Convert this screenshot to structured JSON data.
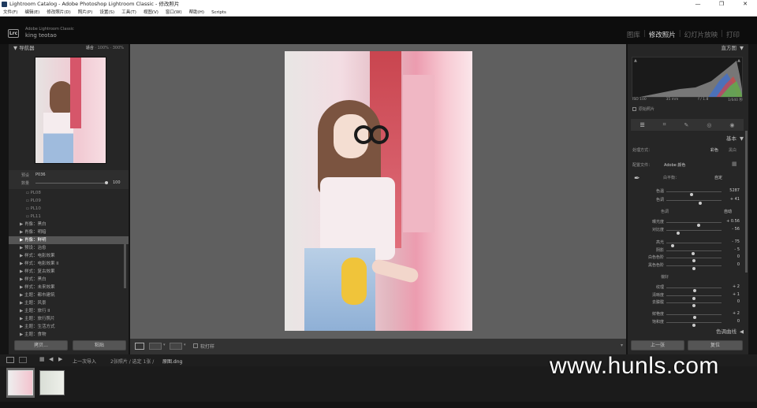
{
  "window": {
    "title": "Lightroom Catalog - Adobe Photoshop Lightroom Classic - 修改照片",
    "controls": [
      "—",
      "❐",
      "✕"
    ]
  },
  "menu": [
    "文件(F)",
    "编辑(E)",
    "修改照片(D)",
    "照片(P)",
    "设置(S)",
    "工具(T)",
    "视图(V)",
    "窗口(W)",
    "帮助(H)",
    "Scripts"
  ],
  "identity": {
    "logo": "Lrc",
    "product": "Adobe Lightroom Classic",
    "user": "king teotao"
  },
  "modules": [
    {
      "label": "图库",
      "active": false
    },
    {
      "label": "修改照片",
      "active": true
    },
    {
      "label": "幻灯片放映",
      "active": false
    },
    {
      "label": "打印",
      "active": false
    }
  ],
  "navigator": {
    "title": "导航器",
    "zoom": [
      "适合",
      "100%",
      "300%"
    ]
  },
  "preset_amount": {
    "preset_label": "预设",
    "preset_value": "P036",
    "amount_label": "数量",
    "amount_value": "100",
    "amount_level": 1.0
  },
  "presets": [
    {
      "label": "PL08",
      "type": "sub"
    },
    {
      "label": "PL09",
      "type": "sub"
    },
    {
      "label": "PL10",
      "type": "sub"
    },
    {
      "label": "PL11",
      "type": "sub"
    },
    {
      "label": "肖像：黑白",
      "type": "folder"
    },
    {
      "label": "肖像：明暗",
      "type": "folder"
    },
    {
      "label": "肖像：鲜明",
      "type": "folder",
      "selected": true
    },
    {
      "label": "预设：治愈",
      "type": "folder"
    },
    {
      "label": "样式：电影效果",
      "type": "folder"
    },
    {
      "label": "样式：电影效果 II",
      "type": "folder"
    },
    {
      "label": "样式：复古效果",
      "type": "folder"
    },
    {
      "label": "样式：黑白",
      "type": "folder"
    },
    {
      "label": "样式：未来效果",
      "type": "folder"
    },
    {
      "label": "主题：都市建筑",
      "type": "folder"
    },
    {
      "label": "主题：风景",
      "type": "folder"
    },
    {
      "label": "主题：旅行 II",
      "type": "folder"
    },
    {
      "label": "主题：旅行照片",
      "type": "folder"
    },
    {
      "label": "主题：生活方式",
      "type": "folder"
    },
    {
      "label": "主题：食物",
      "type": "folder"
    }
  ],
  "left_buttons": {
    "copy": "拷贝...",
    "paste": "粘贴"
  },
  "right_panel": {
    "histogram_title": "直方图",
    "histogram_info": [
      "ISO 100",
      "35 mm",
      "f / 1.8",
      "1/640 秒"
    ],
    "original_photo": "原始照片",
    "basic_title": "基本",
    "treatment_label": "处理方式：",
    "treatment_options": [
      "彩色",
      "黑白"
    ],
    "profile_label": "配置文件：",
    "profile_value": "Adobe 颜色",
    "wb_label": "白平衡：",
    "wb_value": "自定",
    "tone_label": "色调",
    "tone_auto": "自动",
    "presence_label": "偏好",
    "tone_curve_title": "色调曲线",
    "prev_button": "上一张",
    "reset_button": "复位"
  },
  "sliders": [
    {
      "label": "色温",
      "value": "5287",
      "level": 0.45
    },
    {
      "label": "色调",
      "value": "+ 41",
      "level": 0.62
    },
    {
      "label": "曝光度",
      "value": "+ 0.56",
      "level": 0.58
    },
    {
      "label": "对比度",
      "value": "- 56",
      "level": 0.22
    },
    {
      "label": "高光",
      "value": "- 75",
      "level": 0.12
    },
    {
      "label": "阴影",
      "value": "- 5",
      "level": 0.48
    },
    {
      "label": "白色色阶",
      "value": "0",
      "level": 0.5
    },
    {
      "label": "黑色色阶",
      "value": "0",
      "level": 0.5
    },
    {
      "label": "纹理",
      "value": "+ 2",
      "level": 0.51
    },
    {
      "label": "清晰度",
      "value": "+ 1",
      "level": 0.505
    },
    {
      "label": "去朦胧",
      "value": "0",
      "level": 0.5
    },
    {
      "label": "鲜艳度",
      "value": "+ 2",
      "level": 0.51
    },
    {
      "label": "饱和度",
      "value": "0",
      "level": 0.5
    }
  ],
  "toolbar": {
    "soft_proof": "软打样"
  },
  "filmstrip": {
    "source": "上一次导入",
    "count": "2张照片 / 选定 1张 /",
    "file": "原图.dng"
  },
  "watermark": "www.hunls.com"
}
